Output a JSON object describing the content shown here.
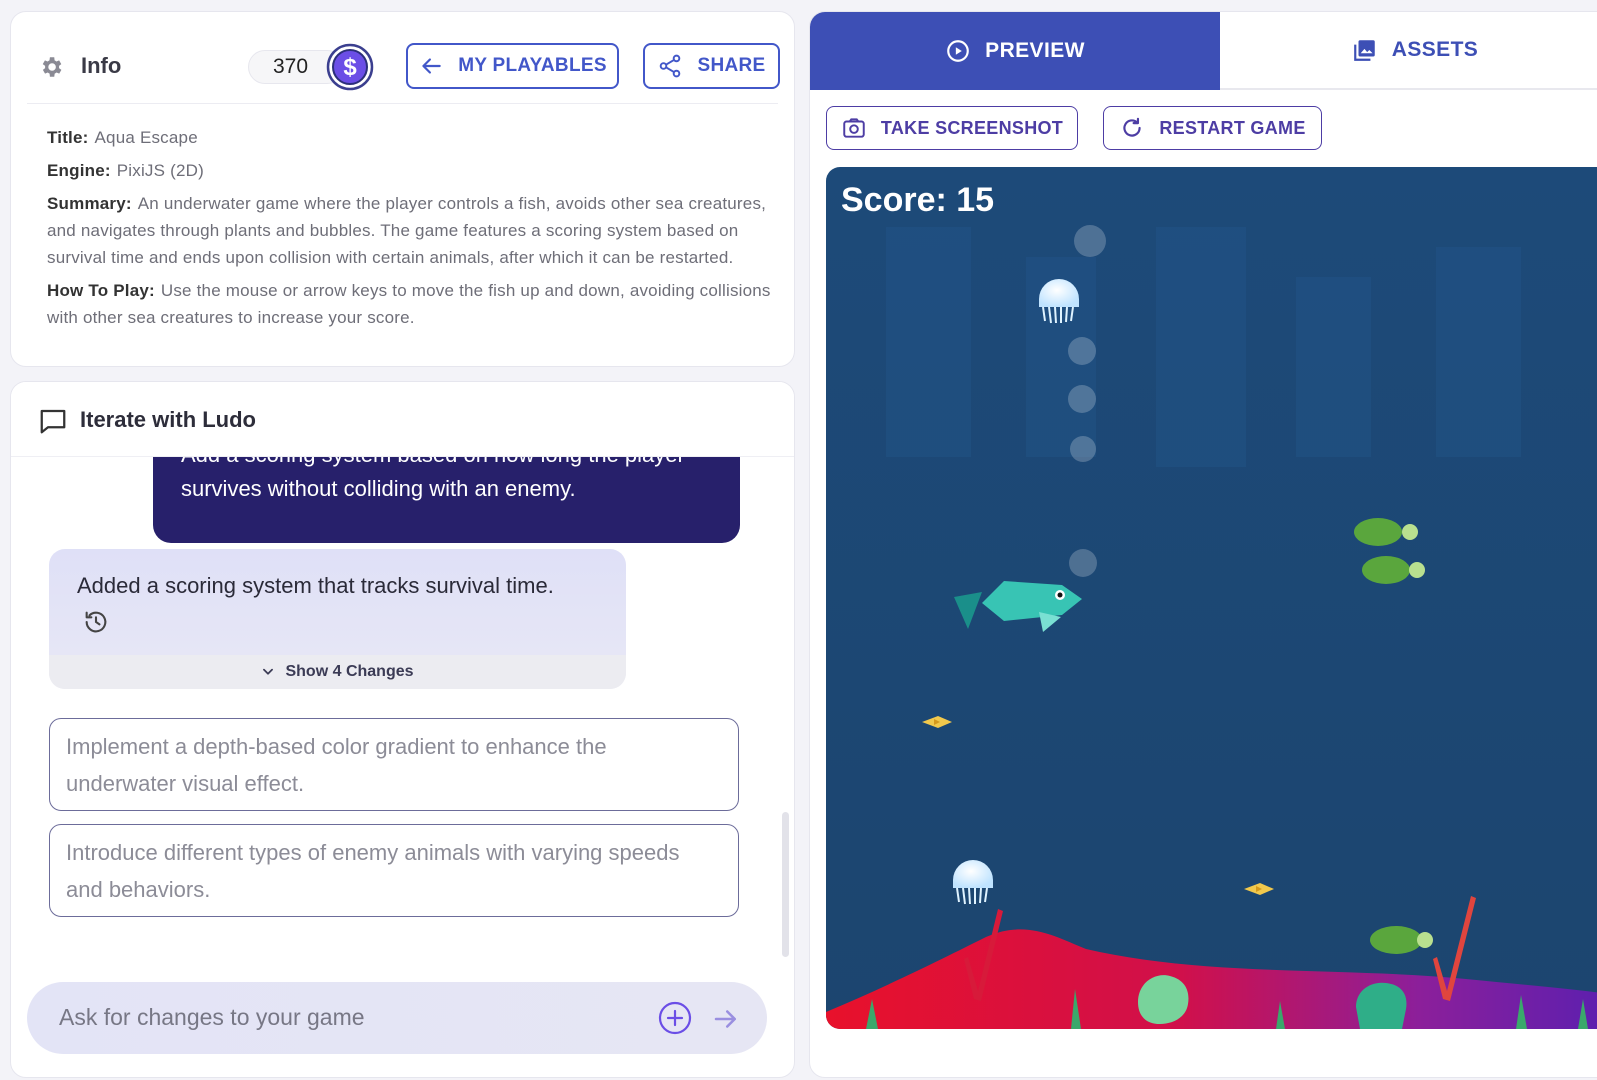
{
  "info": {
    "title": "Info",
    "coins": "370",
    "coin_symbol": "$",
    "my_playables": "MY PLAYABLES",
    "share": "SHARE",
    "fields": {
      "title_label": "Title:",
      "title_value": "Aqua Escape",
      "engine_label": "Engine:",
      "engine_value": "PixiJS (2D)",
      "summary_label": "Summary:",
      "summary_value": "An underwater game where the player controls a fish, avoids other sea creatures, and navigates through plants and bubbles. The game features a scoring system based on survival time and ends upon collision with certain animals, after which it can be restarted.",
      "howto_label": "How To Play:",
      "howto_value": "Use the mouse or arrow keys to move the fish up and down, avoiding collisions with other sea creatures to increase your score."
    }
  },
  "chat": {
    "title": "Iterate with Ludo",
    "user_message": "Add a scoring system based on how long the player survives without colliding with an enemy.",
    "bot_message": "Added a scoring system that tracks survival time.",
    "show_changes": "Show 4 Changes",
    "suggestions": [
      "Implement a depth-based color gradient to enhance the underwater visual effect.",
      "Introduce different types of enemy animals with varying speeds and behaviors."
    ],
    "input_placeholder": "Ask for changes to your game"
  },
  "preview": {
    "tabs": {
      "preview": "PREVIEW",
      "assets": "ASSETS"
    },
    "take_screenshot": "TAKE SCREENSHOT",
    "restart_game": "RESTART GAME",
    "score_text": "Score: 15"
  },
  "colors": {
    "accent": "#3d4fb5",
    "deep_purple": "#27206b",
    "water": "#1f4b7a"
  }
}
